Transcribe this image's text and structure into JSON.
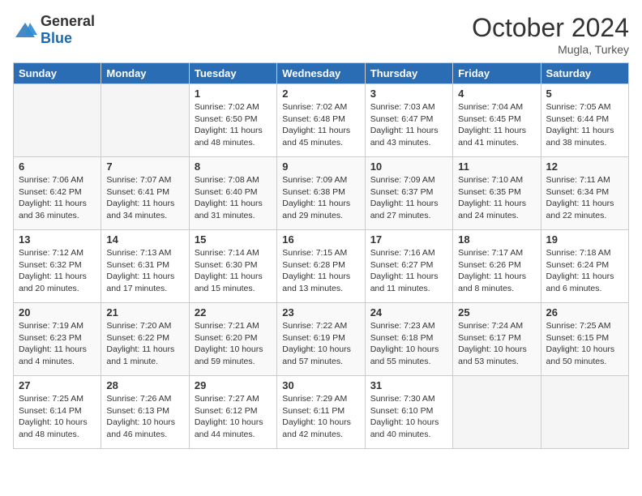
{
  "header": {
    "logo_general": "General",
    "logo_blue": "Blue",
    "month": "October 2024",
    "location": "Mugla, Turkey"
  },
  "days_of_week": [
    "Sunday",
    "Monday",
    "Tuesday",
    "Wednesday",
    "Thursday",
    "Friday",
    "Saturday"
  ],
  "weeks": [
    [
      {
        "day": "",
        "info": ""
      },
      {
        "day": "",
        "info": ""
      },
      {
        "day": "1",
        "info": "Sunrise: 7:02 AM\nSunset: 6:50 PM\nDaylight: 11 hours and 48 minutes."
      },
      {
        "day": "2",
        "info": "Sunrise: 7:02 AM\nSunset: 6:48 PM\nDaylight: 11 hours and 45 minutes."
      },
      {
        "day": "3",
        "info": "Sunrise: 7:03 AM\nSunset: 6:47 PM\nDaylight: 11 hours and 43 minutes."
      },
      {
        "day": "4",
        "info": "Sunrise: 7:04 AM\nSunset: 6:45 PM\nDaylight: 11 hours and 41 minutes."
      },
      {
        "day": "5",
        "info": "Sunrise: 7:05 AM\nSunset: 6:44 PM\nDaylight: 11 hours and 38 minutes."
      }
    ],
    [
      {
        "day": "6",
        "info": "Sunrise: 7:06 AM\nSunset: 6:42 PM\nDaylight: 11 hours and 36 minutes."
      },
      {
        "day": "7",
        "info": "Sunrise: 7:07 AM\nSunset: 6:41 PM\nDaylight: 11 hours and 34 minutes."
      },
      {
        "day": "8",
        "info": "Sunrise: 7:08 AM\nSunset: 6:40 PM\nDaylight: 11 hours and 31 minutes."
      },
      {
        "day": "9",
        "info": "Sunrise: 7:09 AM\nSunset: 6:38 PM\nDaylight: 11 hours and 29 minutes."
      },
      {
        "day": "10",
        "info": "Sunrise: 7:09 AM\nSunset: 6:37 PM\nDaylight: 11 hours and 27 minutes."
      },
      {
        "day": "11",
        "info": "Sunrise: 7:10 AM\nSunset: 6:35 PM\nDaylight: 11 hours and 24 minutes."
      },
      {
        "day": "12",
        "info": "Sunrise: 7:11 AM\nSunset: 6:34 PM\nDaylight: 11 hours and 22 minutes."
      }
    ],
    [
      {
        "day": "13",
        "info": "Sunrise: 7:12 AM\nSunset: 6:32 PM\nDaylight: 11 hours and 20 minutes."
      },
      {
        "day": "14",
        "info": "Sunrise: 7:13 AM\nSunset: 6:31 PM\nDaylight: 11 hours and 17 minutes."
      },
      {
        "day": "15",
        "info": "Sunrise: 7:14 AM\nSunset: 6:30 PM\nDaylight: 11 hours and 15 minutes."
      },
      {
        "day": "16",
        "info": "Sunrise: 7:15 AM\nSunset: 6:28 PM\nDaylight: 11 hours and 13 minutes."
      },
      {
        "day": "17",
        "info": "Sunrise: 7:16 AM\nSunset: 6:27 PM\nDaylight: 11 hours and 11 minutes."
      },
      {
        "day": "18",
        "info": "Sunrise: 7:17 AM\nSunset: 6:26 PM\nDaylight: 11 hours and 8 minutes."
      },
      {
        "day": "19",
        "info": "Sunrise: 7:18 AM\nSunset: 6:24 PM\nDaylight: 11 hours and 6 minutes."
      }
    ],
    [
      {
        "day": "20",
        "info": "Sunrise: 7:19 AM\nSunset: 6:23 PM\nDaylight: 11 hours and 4 minutes."
      },
      {
        "day": "21",
        "info": "Sunrise: 7:20 AM\nSunset: 6:22 PM\nDaylight: 11 hours and 1 minute."
      },
      {
        "day": "22",
        "info": "Sunrise: 7:21 AM\nSunset: 6:20 PM\nDaylight: 10 hours and 59 minutes."
      },
      {
        "day": "23",
        "info": "Sunrise: 7:22 AM\nSunset: 6:19 PM\nDaylight: 10 hours and 57 minutes."
      },
      {
        "day": "24",
        "info": "Sunrise: 7:23 AM\nSunset: 6:18 PM\nDaylight: 10 hours and 55 minutes."
      },
      {
        "day": "25",
        "info": "Sunrise: 7:24 AM\nSunset: 6:17 PM\nDaylight: 10 hours and 53 minutes."
      },
      {
        "day": "26",
        "info": "Sunrise: 7:25 AM\nSunset: 6:15 PM\nDaylight: 10 hours and 50 minutes."
      }
    ],
    [
      {
        "day": "27",
        "info": "Sunrise: 7:25 AM\nSunset: 6:14 PM\nDaylight: 10 hours and 48 minutes."
      },
      {
        "day": "28",
        "info": "Sunrise: 7:26 AM\nSunset: 6:13 PM\nDaylight: 10 hours and 46 minutes."
      },
      {
        "day": "29",
        "info": "Sunrise: 7:27 AM\nSunset: 6:12 PM\nDaylight: 10 hours and 44 minutes."
      },
      {
        "day": "30",
        "info": "Sunrise: 7:29 AM\nSunset: 6:11 PM\nDaylight: 10 hours and 42 minutes."
      },
      {
        "day": "31",
        "info": "Sunrise: 7:30 AM\nSunset: 6:10 PM\nDaylight: 10 hours and 40 minutes."
      },
      {
        "day": "",
        "info": ""
      },
      {
        "day": "",
        "info": ""
      }
    ]
  ]
}
